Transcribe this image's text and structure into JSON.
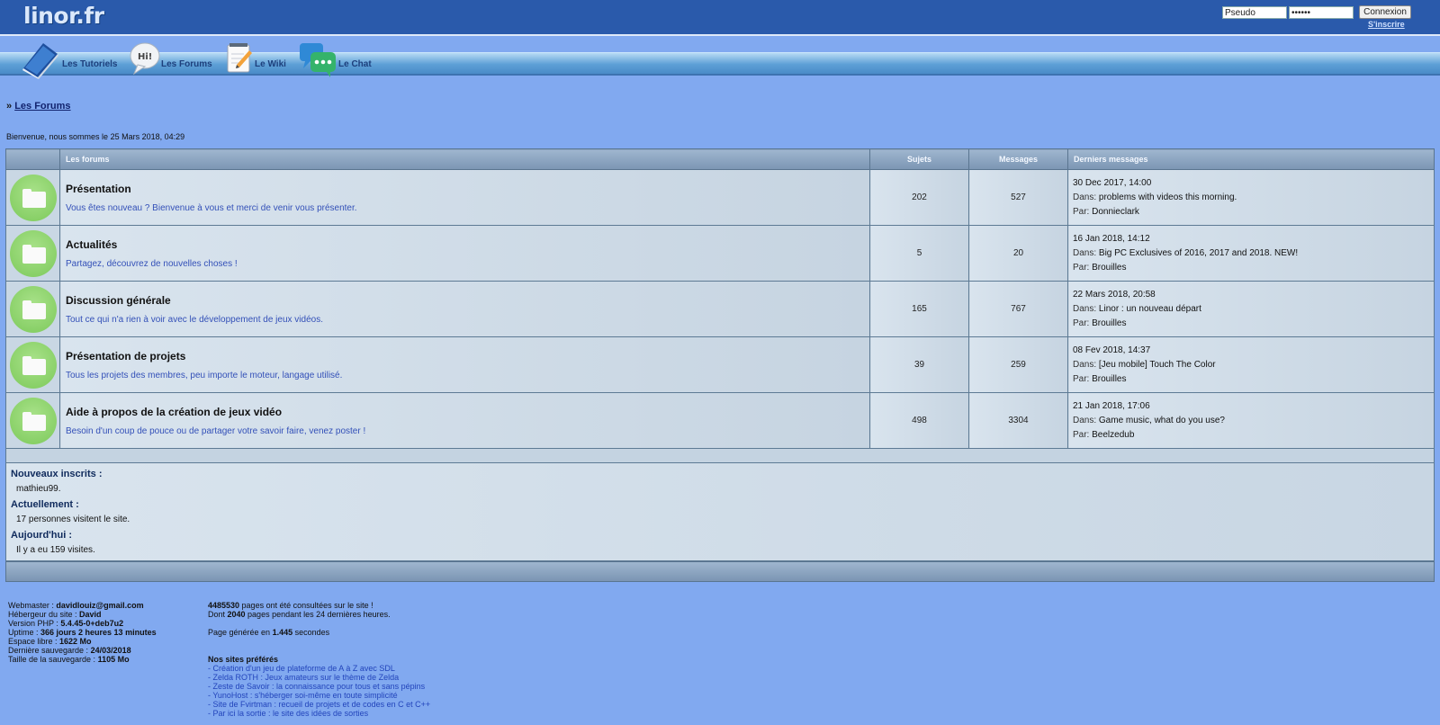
{
  "site": {
    "logo": "linor.fr"
  },
  "login": {
    "pseudo_value": "Pseudo",
    "password_value": "••••••",
    "connect_label": "Connexion",
    "register_label": "S'inscrire"
  },
  "nav": {
    "items": [
      {
        "label": "Les Tutoriels",
        "icon": "book-icon"
      },
      {
        "label": "Les Forums",
        "icon": "speech-bubble-hi-icon"
      },
      {
        "label": "Le Wiki",
        "icon": "notepad-pencil-icon"
      },
      {
        "label": "Le Chat",
        "icon": "chat-bubbles-icon"
      }
    ]
  },
  "breadcrumb": {
    "prefix": "»",
    "link": "Les Forums"
  },
  "welcome": "Bienvenue, nous sommes le 25 Mars 2018, 04:29",
  "table": {
    "headers": {
      "forums": "Les forums",
      "subjects": "Sujets",
      "messages": "Messages",
      "last": "Derniers messages"
    },
    "dans_label": "Dans:",
    "par_label": "Par:",
    "rows": [
      {
        "title": "Présentation",
        "desc": "Vous êtes nouveau ? Bienvenue à vous et merci de venir vous présenter.",
        "subjects": "202",
        "messages": "527",
        "last_date": "30 Dec 2017, 14:00",
        "last_topic": "problems with videos this morning.",
        "last_author": "Donnieclark"
      },
      {
        "title": "Actualités",
        "desc": "Partagez, découvrez de nouvelles choses !",
        "subjects": "5",
        "messages": "20",
        "last_date": "16 Jan 2018, 14:12",
        "last_topic": "Big PC Exclusives of 2016, 2017 and 2018. NEW!",
        "last_author": "Brouilles"
      },
      {
        "title": "Discussion générale",
        "desc": "Tout ce qui n'a rien à voir avec le développement de jeux vidéos.",
        "subjects": "165",
        "messages": "767",
        "last_date": "22 Mars 2018, 20:58",
        "last_topic": "Linor : un nouveau départ",
        "last_author": "Brouilles"
      },
      {
        "title": "Présentation de projets",
        "desc": "Tous les projets des membres, peu importe le moteur, langage utilisé.",
        "subjects": "39",
        "messages": "259",
        "last_date": "08 Fev 2018, 14:37",
        "last_topic": "[Jeu mobile] Touch The Color",
        "last_author": "Brouilles"
      },
      {
        "title": "Aide à propos de la création de jeux vidéo",
        "desc": "Besoin d'un coup de pouce ou de partager votre savoir faire, venez poster !",
        "subjects": "498",
        "messages": "3304",
        "last_date": "21 Jan 2018, 17:06",
        "last_topic": "Game music, what do you use?",
        "last_author": "Beelzedub"
      }
    ]
  },
  "stats": {
    "new_members_label": "Nouveaux inscrits :",
    "new_members_value": "mathieu99.",
    "current_label": "Actuellement :",
    "current_value": "17 personnes visitent le site.",
    "today_label": "Aujourd'hui :",
    "today_value": "Il y a eu 159 visites."
  },
  "footer": {
    "left": [
      {
        "label": "Webmaster : ",
        "value": "davidlouiz@gmail.com"
      },
      {
        "label": "Hébergeur du site : ",
        "value": "David"
      },
      {
        "label": "Version PHP : ",
        "value": "5.4.45-0+deb7u2"
      },
      {
        "label": "Uptime : ",
        "value": "366 jours 2 heures 13 minutes"
      },
      {
        "label": "Espace libre : ",
        "value": "1622 Mo"
      },
      {
        "label": "Dernière sauvegarde : ",
        "value": "24/03/2018"
      },
      {
        "label": "Taille de la sauvegarde : ",
        "value": "1105 Mo"
      }
    ],
    "pages_count": "4485530",
    "pages_text": " pages ont été consultées sur le site !",
    "dont_label": "Dont ",
    "pages_24h": "2040",
    "pages_24h_text": " pages pendant les 24 dernières heures.",
    "generated_label": "Page générée en ",
    "generated_time": "1.445",
    "generated_unit": " secondes",
    "fav_title": "Nos sites préférés",
    "fav_sites": [
      "- Création d'un jeu de plateforme de A à Z avec SDL",
      "- Zelda ROTH : Jeux amateurs sur le thème de Zelda",
      "- Zeste de Savoir : la connaissance pour tous et sans pépins",
      "- YunoHost : s'héberger soi-même en toute simplicité",
      "- Site de Fvirtman : recueil de projets et de codes en C et C++",
      "- Par ici la sortie : le site des idées de sorties"
    ]
  }
}
